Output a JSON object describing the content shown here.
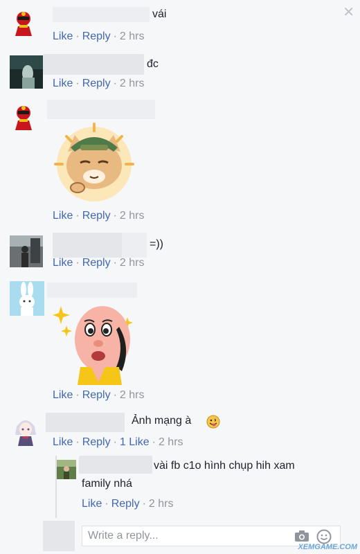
{
  "actions": {
    "like": "Like",
    "reply": "Reply",
    "separator": "·"
  },
  "comments": [
    {
      "text": "vái",
      "time": "2 hrs"
    },
    {
      "text": "đc",
      "time": "2 hrs"
    },
    {
      "text": "",
      "time": "2 hrs"
    },
    {
      "text": "=))",
      "time": "2 hrs"
    },
    {
      "text": "",
      "time": "2 hrs"
    },
    {
      "text": "Ảnh mạng à",
      "likes": "1 Like",
      "time": "2 hrs"
    }
  ],
  "reply": {
    "line1": "vài fb c1o hình chụp hih xam",
    "line2": "family nhá",
    "time": "2 hrs"
  },
  "reply_input": {
    "placeholder": "Write a reply..."
  },
  "watermark": "XEMGAME.COM",
  "colors": {
    "link": "#4267b2",
    "meta": "#90949c",
    "text": "#1d2129",
    "background": "#f6f7f9"
  }
}
